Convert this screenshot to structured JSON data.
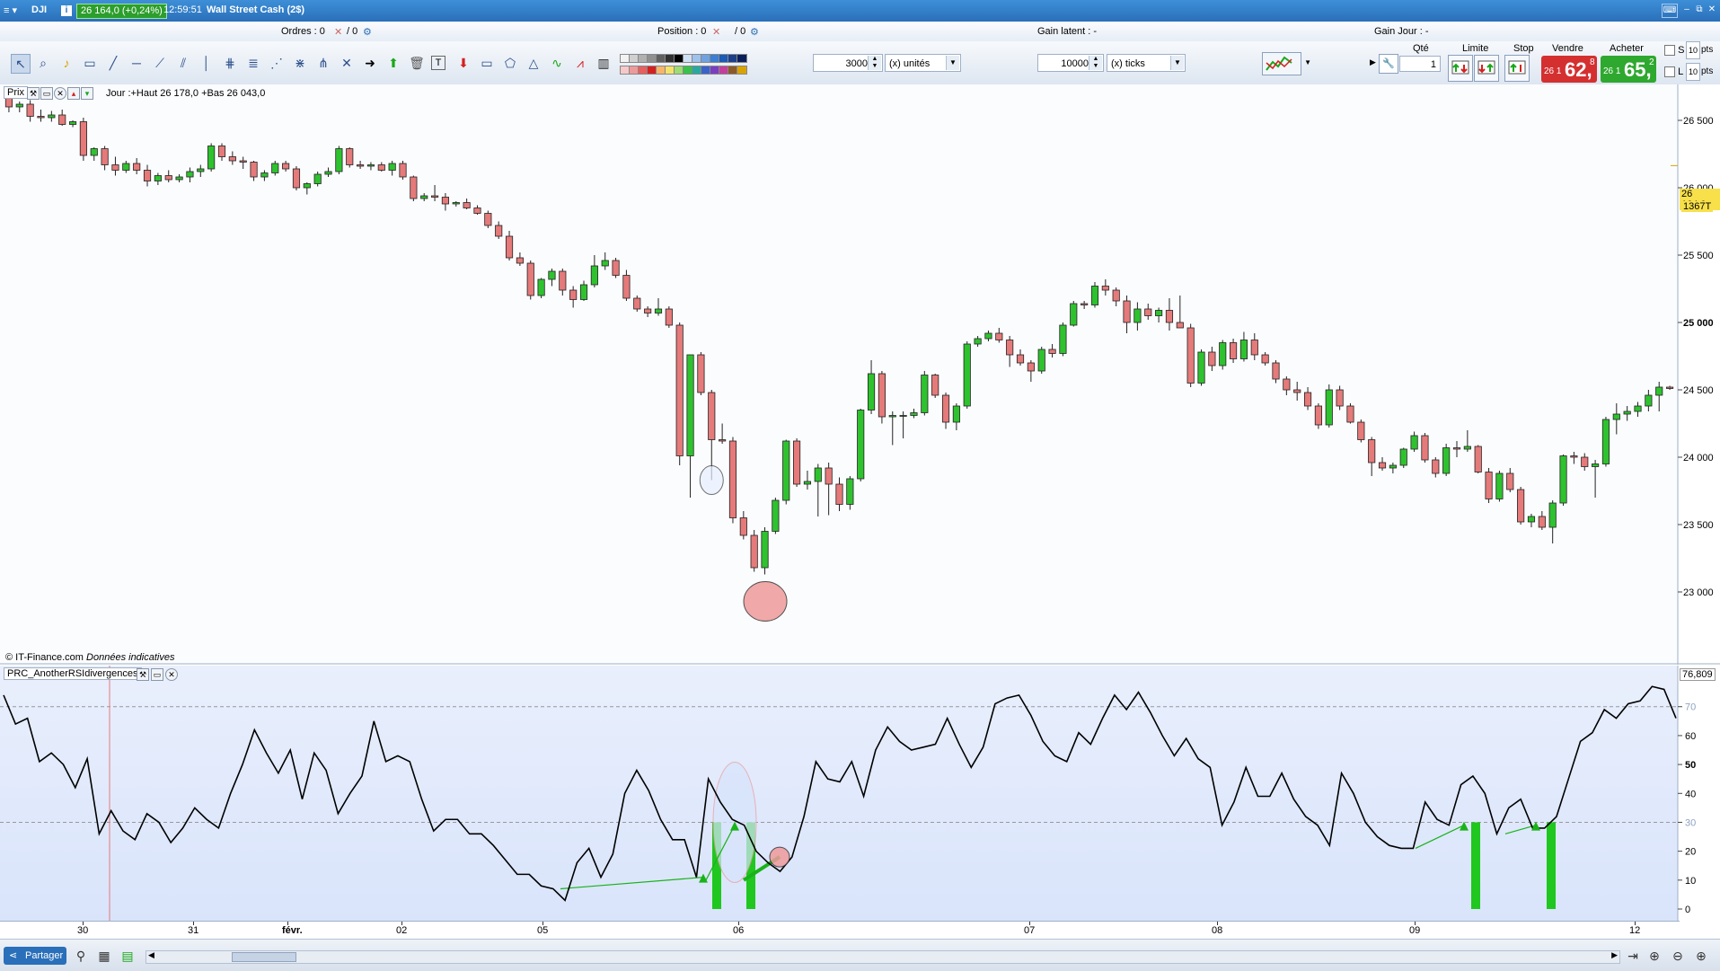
{
  "titlebar": {
    "symbol": "DJI",
    "price_badge": "26 164,0 (+0,24%)",
    "time": "12:59:51",
    "instrument": "Wall Street Cash (2$)"
  },
  "infobar": {
    "orders": "Ordres : 0",
    "orders_count": "/ 0",
    "position": "Position : 0",
    "position_count": "/ 0",
    "gain_latent": "Gain latent : -",
    "gain_jour": "Gain Jour : -"
  },
  "toolbar": {
    "units_value": "3000",
    "units_label": "(x) unités",
    "ticks_value": "10000",
    "ticks_label": "(x) ticks"
  },
  "order_panel": {
    "qty_label": "Qté",
    "qty_value": "1",
    "limit_label": "Limite",
    "stop_label": "Stop",
    "sell_label": "Vendre",
    "buy_label": "Acheter",
    "sell_prefix": "26 1",
    "sell_big": "62,",
    "sell_small": "8",
    "buy_prefix": "26 1",
    "buy_big": "65,",
    "buy_small": "2",
    "s_label": "S",
    "l_label": "L",
    "pts_value": "10",
    "pts_label": "pts"
  },
  "price_panel": {
    "label": "Prix",
    "info": "Jour :+Haut 26 178,0 +Bas 26 043,0",
    "source": "© IT-Finance.com",
    "source_note": "Données indicatives",
    "last_price_tag": "26 164,0",
    "countdown_tag": "1367T",
    "y_ticks": [
      "26 500",
      "26 000",
      "25 500",
      "25 000",
      "24 500",
      "24 000",
      "23 500",
      "23 000"
    ]
  },
  "rsi_panel": {
    "label": "PRC_AnotherRSIdivergences",
    "last_value_tag": "76,809",
    "y_ticks": [
      "70",
      "60",
      "50",
      "40",
      "30",
      "20",
      "10",
      "0"
    ]
  },
  "x_axis": {
    "labels": [
      "30",
      "31",
      "févr.",
      "02",
      "05",
      "06",
      "07",
      "08",
      "09",
      "12"
    ]
  },
  "bottombar": {
    "share_label": "Partager"
  },
  "colors": {
    "up": "#2fc22f",
    "down": "#e57a7a",
    "rsi_line": "#000000",
    "signal_bar": "#1fc71f"
  },
  "chart_data": [
    {
      "type": "candlestick",
      "y_ticks": [
        23000,
        23500,
        24000,
        24500,
        25000,
        25500,
        26000,
        26500
      ],
      "ylim": [
        22600,
        26700
      ],
      "last_price": 26164.0,
      "candles": [
        [
          26700,
          26750,
          26560,
          26600
        ],
        [
          26600,
          26640,
          26560,
          26620
        ],
        [
          26620,
          26650,
          26490,
          26530
        ],
        [
          26530,
          26580,
          26490,
          26520
        ],
        [
          26520,
          26570,
          26490,
          26540
        ],
        [
          26540,
          26580,
          26460,
          26470
        ],
        [
          26470,
          26500,
          26450,
          26490
        ],
        [
          26490,
          26520,
          26200,
          26240
        ],
        [
          26240,
          26300,
          26200,
          26290
        ],
        [
          26290,
          26310,
          26130,
          26170
        ],
        [
          26170,
          26230,
          26090,
          26130
        ],
        [
          26130,
          26200,
          26110,
          26180
        ],
        [
          26180,
          26220,
          26100,
          26130
        ],
        [
          26130,
          26170,
          26010,
          26050
        ],
        [
          26050,
          26110,
          26020,
          26090
        ],
        [
          26090,
          26130,
          26040,
          26060
        ],
        [
          26060,
          26100,
          26040,
          26080
        ],
        [
          26080,
          26150,
          26040,
          26120
        ],
        [
          26120,
          26170,
          26080,
          26140
        ],
        [
          26140,
          26330,
          26120,
          26310
        ],
        [
          26310,
          26330,
          26200,
          26230
        ],
        [
          26230,
          26270,
          26170,
          26200
        ],
        [
          26200,
          26230,
          26140,
          26190
        ],
        [
          26190,
          26200,
          26050,
          26080
        ],
        [
          26080,
          26130,
          26050,
          26110
        ],
        [
          26110,
          26200,
          26090,
          26180
        ],
        [
          26180,
          26200,
          26120,
          26140
        ],
        [
          26140,
          26160,
          25980,
          26000
        ],
        [
          26000,
          26040,
          25950,
          26030
        ],
        [
          26030,
          26120,
          26010,
          26100
        ],
        [
          26100,
          26150,
          26080,
          26120
        ],
        [
          26120,
          26310,
          26100,
          26290
        ],
        [
          26290,
          26300,
          26150,
          26170
        ],
        [
          26170,
          26200,
          26140,
          26160
        ],
        [
          26160,
          26190,
          26130,
          26170
        ],
        [
          26170,
          26190,
          26120,
          26130
        ],
        [
          26130,
          26200,
          26090,
          26180
        ],
        [
          26180,
          26200,
          26060,
          26080
        ],
        [
          26080,
          26090,
          25900,
          25920
        ],
        [
          25920,
          25960,
          25900,
          25940
        ],
        [
          25940,
          26020,
          25900,
          25930
        ],
        [
          25930,
          25960,
          25830,
          25880
        ],
        [
          25880,
          25900,
          25860,
          25890
        ],
        [
          25890,
          25920,
          25840,
          25850
        ],
        [
          25850,
          25870,
          25800,
          25810
        ],
        [
          25810,
          25830,
          25700,
          25720
        ],
        [
          25720,
          25750,
          25620,
          25640
        ],
        [
          25640,
          25680,
          25460,
          25480
        ],
        [
          25480,
          25520,
          25420,
          25440
        ],
        [
          25440,
          25460,
          25170,
          25200
        ],
        [
          25200,
          25330,
          25180,
          25320
        ],
        [
          25320,
          25400,
          25270,
          25380
        ],
        [
          25380,
          25400,
          25200,
          25240
        ],
        [
          25240,
          25270,
          25110,
          25170
        ],
        [
          25170,
          25310,
          25160,
          25280
        ],
        [
          25280,
          25500,
          25260,
          25420
        ],
        [
          25420,
          25520,
          25390,
          25460
        ],
        [
          25460,
          25480,
          25330,
          25350
        ],
        [
          25350,
          25390,
          25160,
          25180
        ],
        [
          25180,
          25200,
          25080,
          25100
        ],
        [
          25100,
          25120,
          25040,
          25070
        ],
        [
          25070,
          25180,
          25050,
          25100
        ],
        [
          25100,
          25120,
          24960,
          24980
        ],
        [
          24980,
          25000,
          23940,
          24010
        ],
        [
          24010,
          24600,
          23700,
          24760
        ],
        [
          24760,
          24780,
          24460,
          24480
        ],
        [
          24480,
          24500,
          23830,
          24130
        ],
        [
          24130,
          24250,
          24100,
          24120
        ],
        [
          24120,
          24150,
          23510,
          23550
        ],
        [
          23550,
          23600,
          23390,
          23420
        ],
        [
          23420,
          23460,
          23150,
          23180
        ],
        [
          23180,
          23480,
          23130,
          23450
        ],
        [
          23450,
          23700,
          23430,
          23680
        ],
        [
          23680,
          24130,
          23650,
          24120
        ],
        [
          24120,
          24140,
          23780,
          23800
        ],
        [
          23800,
          23900,
          23760,
          23820
        ],
        [
          23820,
          23950,
          23560,
          23920
        ],
        [
          23920,
          23960,
          23570,
          23800
        ],
        [
          23800,
          23850,
          23600,
          23650
        ],
        [
          23650,
          23860,
          23610,
          23840
        ],
        [
          23840,
          24360,
          23820,
          24350
        ],
        [
          24350,
          24720,
          24320,
          24620
        ],
        [
          24620,
          24640,
          24250,
          24300
        ],
        [
          24300,
          24340,
          24090,
          24310
        ],
        [
          24310,
          24340,
          24140,
          24310
        ],
        [
          24310,
          24360,
          24290,
          24330
        ],
        [
          24330,
          24640,
          24310,
          24610
        ],
        [
          24610,
          24620,
          24440,
          24460
        ],
        [
          24460,
          24480,
          24210,
          24260
        ],
        [
          24260,
          24400,
          24200,
          24380
        ],
        [
          24380,
          24860,
          24360,
          24840
        ],
        [
          24840,
          24900,
          24820,
          24880
        ],
        [
          24880,
          24940,
          24860,
          24920
        ],
        [
          24920,
          24960,
          24850,
          24870
        ],
        [
          24870,
          24900,
          24670,
          24760
        ],
        [
          24760,
          24800,
          24680,
          24700
        ],
        [
          24700,
          24720,
          24560,
          24640
        ],
        [
          24640,
          24820,
          24620,
          24800
        ],
        [
          24800,
          24840,
          24740,
          24770
        ],
        [
          24770,
          25000,
          24750,
          24980
        ],
        [
          24980,
          25160,
          24970,
          25140
        ],
        [
          25140,
          25160,
          25100,
          25130
        ],
        [
          25130,
          25300,
          25110,
          25270
        ],
        [
          25270,
          25320,
          25200,
          25240
        ],
        [
          25240,
          25260,
          25120,
          25160
        ],
        [
          25160,
          25200,
          24920,
          25000
        ],
        [
          25000,
          25150,
          24940,
          25100
        ],
        [
          25100,
          25140,
          25020,
          25050
        ],
        [
          25050,
          25110,
          25000,
          25090
        ],
        [
          25090,
          25180,
          24940,
          25000
        ],
        [
          25000,
          25200,
          24980,
          24960
        ],
        [
          24960,
          24990,
          24520,
          24550
        ],
        [
          24550,
          24800,
          24530,
          24780
        ],
        [
          24780,
          24820,
          24640,
          24680
        ],
        [
          24680,
          24870,
          24650,
          24850
        ],
        [
          24850,
          24880,
          24700,
          24730
        ],
        [
          24730,
          24930,
          24710,
          24870
        ],
        [
          24870,
          24920,
          24720,
          24760
        ],
        [
          24760,
          24780,
          24680,
          24700
        ],
        [
          24700,
          24720,
          24550,
          24580
        ],
        [
          24580,
          24600,
          24460,
          24500
        ],
        [
          24500,
          24560,
          24420,
          24480
        ],
        [
          24480,
          24520,
          24350,
          24380
        ],
        [
          24380,
          24400,
          24210,
          24240
        ],
        [
          24240,
          24540,
          24220,
          24500
        ],
        [
          24500,
          24530,
          24350,
          24380
        ],
        [
          24380,
          24400,
          24250,
          24260
        ],
        [
          24260,
          24280,
          24110,
          24130
        ],
        [
          24130,
          24150,
          23860,
          23960
        ],
        [
          23960,
          24000,
          23900,
          23920
        ],
        [
          23920,
          23960,
          23880,
          23940
        ],
        [
          23940,
          24070,
          23920,
          24060
        ],
        [
          24060,
          24190,
          24040,
          24160
        ],
        [
          24160,
          24180,
          23960,
          23980
        ],
        [
          23980,
          24000,
          23850,
          23880
        ],
        [
          23880,
          24100,
          23860,
          24070
        ],
        [
          24070,
          24120,
          24000,
          24060
        ],
        [
          24060,
          24200,
          24040,
          24080
        ],
        [
          24080,
          24090,
          23880,
          23890
        ],
        [
          23890,
          23920,
          23660,
          23690
        ],
        [
          23690,
          23900,
          23670,
          23880
        ],
        [
          23880,
          23920,
          23740,
          23760
        ],
        [
          23760,
          23780,
          23500,
          23520
        ],
        [
          23520,
          23580,
          23480,
          23560
        ],
        [
          23560,
          23600,
          23460,
          23480
        ],
        [
          23480,
          23680,
          23360,
          23660
        ],
        [
          23660,
          24020,
          23640,
          24010
        ],
        [
          24010,
          24040,
          23950,
          24000
        ],
        [
          24000,
          24030,
          23900,
          23930
        ],
        [
          23930,
          23980,
          23700,
          23950
        ],
        [
          23950,
          24300,
          23930,
          24280
        ],
        [
          24280,
          24400,
          24170,
          24320
        ],
        [
          24320,
          24380,
          24270,
          24340
        ],
        [
          24340,
          24410,
          24300,
          24380
        ],
        [
          24380,
          24500,
          24340,
          24460
        ],
        [
          24460,
          24560,
          24340,
          24520
        ],
        [
          24520,
          24530,
          24500,
          24510
        ]
      ]
    },
    {
      "type": "line",
      "name": "PRC_AnotherRSIdivergences",
      "ylim": [
        0,
        78
      ],
      "y_ticks": [
        0,
        10,
        20,
        30,
        40,
        50,
        60,
        70
      ],
      "levels": [
        30,
        70
      ],
      "last_value": 76.809,
      "values": [
        74,
        64,
        66,
        51,
        54,
        50,
        42,
        52,
        26,
        34,
        27,
        24,
        33,
        30,
        23,
        28,
        35,
        31,
        28,
        40,
        50,
        62,
        54,
        47,
        55,
        38,
        54,
        48,
        33,
        40,
        46,
        65,
        51,
        53,
        51,
        38,
        27,
        31,
        31,
        26,
        26,
        22,
        17,
        12,
        12,
        8,
        7,
        3,
        16,
        21,
        11,
        19,
        40,
        48,
        41,
        31,
        24,
        24,
        11,
        45,
        37,
        31,
        29,
        20,
        16,
        13,
        18,
        32,
        51,
        45,
        44,
        51,
        39,
        55,
        63,
        58,
        55,
        56,
        57,
        66,
        57,
        49,
        56,
        71,
        73,
        74,
        67,
        58,
        53,
        51,
        61,
        57,
        66,
        74,
        69,
        75,
        68,
        60,
        53,
        59,
        52,
        49,
        29,
        37,
        49,
        39,
        39,
        47,
        38,
        32,
        29,
        22,
        47,
        40,
        30,
        25,
        22,
        21,
        21,
        37,
        31,
        29,
        43,
        46,
        40,
        26,
        35,
        38,
        28,
        28,
        32,
        45,
        58,
        61,
        69,
        66,
        71,
        72,
        77,
        76,
        66
      ]
    }
  ]
}
